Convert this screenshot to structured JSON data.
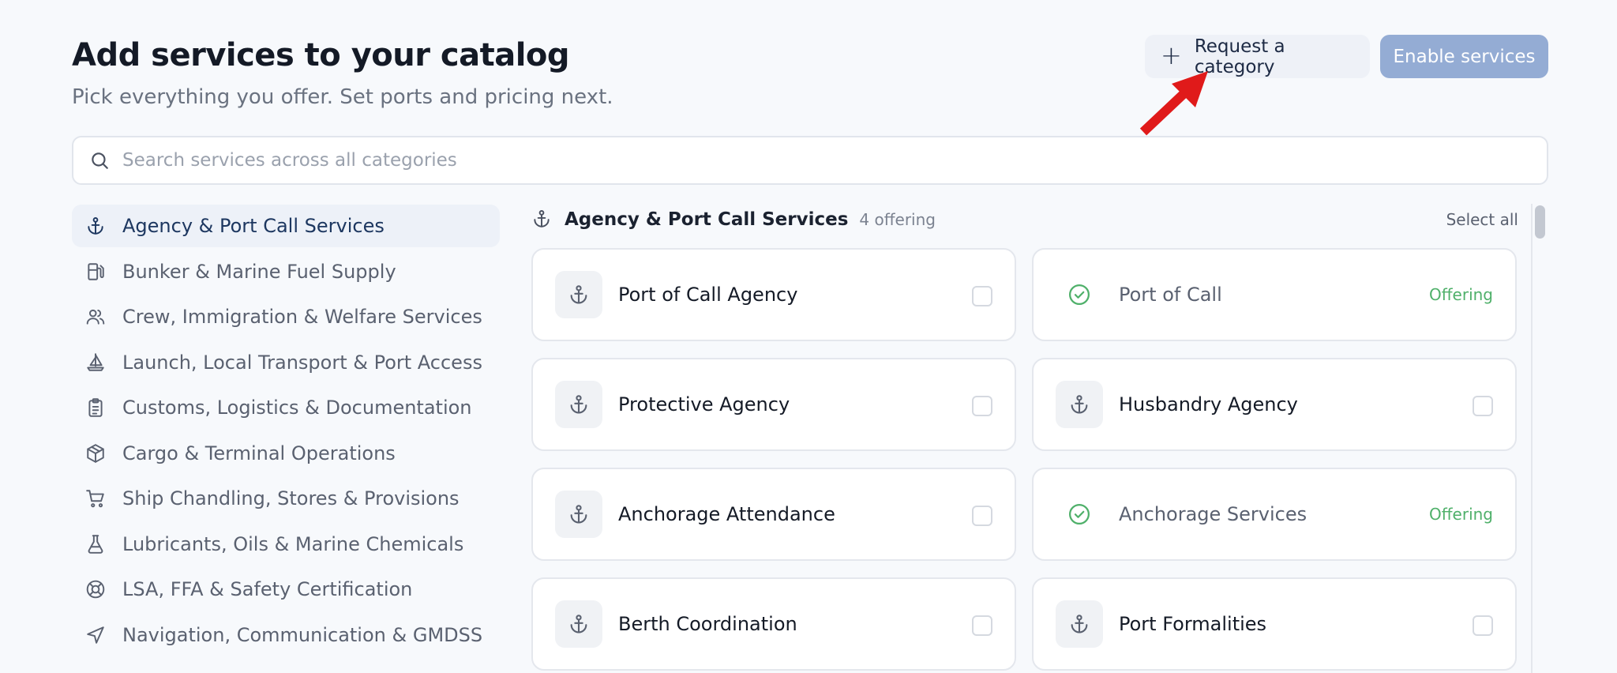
{
  "header": {
    "title": "Add services to your catalog",
    "subtitle": "Pick everything you offer. Set ports and pricing next.",
    "request_label": "Request a category",
    "enable_label": "Enable services"
  },
  "search": {
    "placeholder": "Search services across all categories",
    "value": ""
  },
  "sidebar": {
    "items": [
      {
        "label": "Agency & Port Call Services",
        "icon": "anchor-icon",
        "active": true
      },
      {
        "label": "Bunker & Marine Fuel Supply",
        "icon": "fuel-pump-icon"
      },
      {
        "label": "Crew, Immigration & Welfare Services",
        "icon": "users-icon"
      },
      {
        "label": "Launch, Local Transport & Port Access",
        "icon": "sailboat-icon"
      },
      {
        "label": "Customs, Logistics & Documentation",
        "icon": "clipboard-icon"
      },
      {
        "label": "Cargo & Terminal Operations",
        "icon": "package-icon"
      },
      {
        "label": "Ship Chandling, Stores & Provisions",
        "icon": "cart-icon"
      },
      {
        "label": "Lubricants, Oils & Marine Chemicals",
        "icon": "flask-icon"
      },
      {
        "label": "LSA, FFA & Safety Certification",
        "icon": "lifebuoy-icon"
      },
      {
        "label": "Navigation, Communication & GMDSS",
        "icon": "navigation-icon"
      }
    ]
  },
  "content": {
    "section_title": "Agency & Port Call Services",
    "count_label": "4 offering",
    "select_all": "Select all",
    "offering_label": "Offering",
    "services": [
      {
        "name": "Port of Call Agency",
        "offering": false
      },
      {
        "name": "Port of Call",
        "offering": true
      },
      {
        "name": "Protective Agency",
        "offering": false
      },
      {
        "name": "Husbandry Agency",
        "offering": false
      },
      {
        "name": "Anchorage Attendance",
        "offering": false
      },
      {
        "name": "Anchorage Services",
        "offering": true
      },
      {
        "name": "Berth Coordination",
        "offering": false
      },
      {
        "name": "Port Formalities",
        "offering": false
      }
    ]
  },
  "colors": {
    "accent_active": "#1d3760",
    "enable_button": "#94acd4",
    "offering_green": "#4fb06a",
    "annotation_arrow": "#e01a1a"
  }
}
